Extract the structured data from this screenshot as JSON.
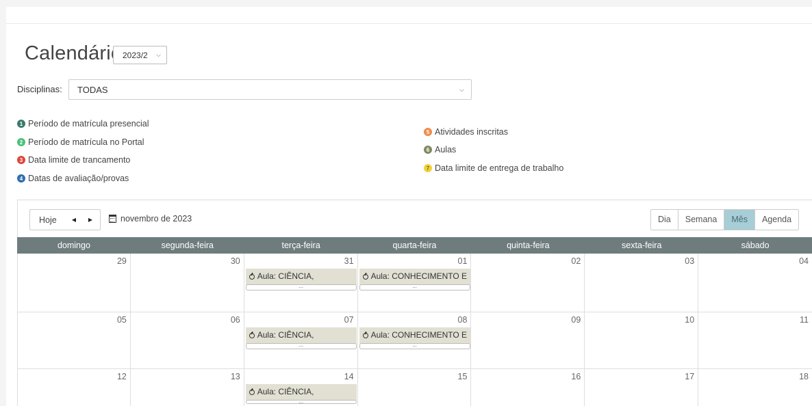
{
  "title": "Calendário:",
  "semester": "2023/2",
  "disciplinas": {
    "label": "Disciplinas:",
    "value": "TODAS"
  },
  "legend": [
    {
      "n": "1",
      "text": "Período de matrícula presencial",
      "color": "#3c7a6e"
    },
    {
      "n": "2",
      "text": "Período de matrícula no Portal",
      "color": "#4cc17a"
    },
    {
      "n": "3",
      "text": "Data limite de trancamento",
      "color": "#e0453b"
    },
    {
      "n": "4",
      "text": "Datas de avaliação/provas",
      "color": "#2f6fb0"
    },
    {
      "n": "5",
      "text": "Atividades inscritas",
      "color": "#f08a4b"
    },
    {
      "n": "6",
      "text": "Aulas",
      "color": "#7f8a5f"
    },
    {
      "n": "7",
      "text": "Data limite de entrega de trabalho",
      "color": "#f0d23c"
    }
  ],
  "toolbar": {
    "today": "Hoje",
    "prev": "◀",
    "next": "▶",
    "month_label": "novembro de 2023"
  },
  "views": [
    "Dia",
    "Semana",
    "Mês",
    "Agenda"
  ],
  "active_view": "Mês",
  "weekdays": [
    "domingo",
    "segunda-feira",
    "terça-feira",
    "quarta-feira",
    "quinta-feira",
    "sexta-feira",
    "sábado"
  ],
  "weeks": [
    {
      "days": [
        "29",
        "30",
        "31",
        "01",
        "02",
        "03",
        "04"
      ]
    },
    {
      "days": [
        "05",
        "06",
        "07",
        "08",
        "09",
        "10",
        "11"
      ]
    },
    {
      "days": [
        "12",
        "13",
        "14",
        "15",
        "16",
        "17",
        "18"
      ]
    }
  ],
  "events": {
    "tue": "Aula: CIÊNCIA,",
    "wed": "Aula: CONHECIMENTO E",
    "more": "..."
  }
}
